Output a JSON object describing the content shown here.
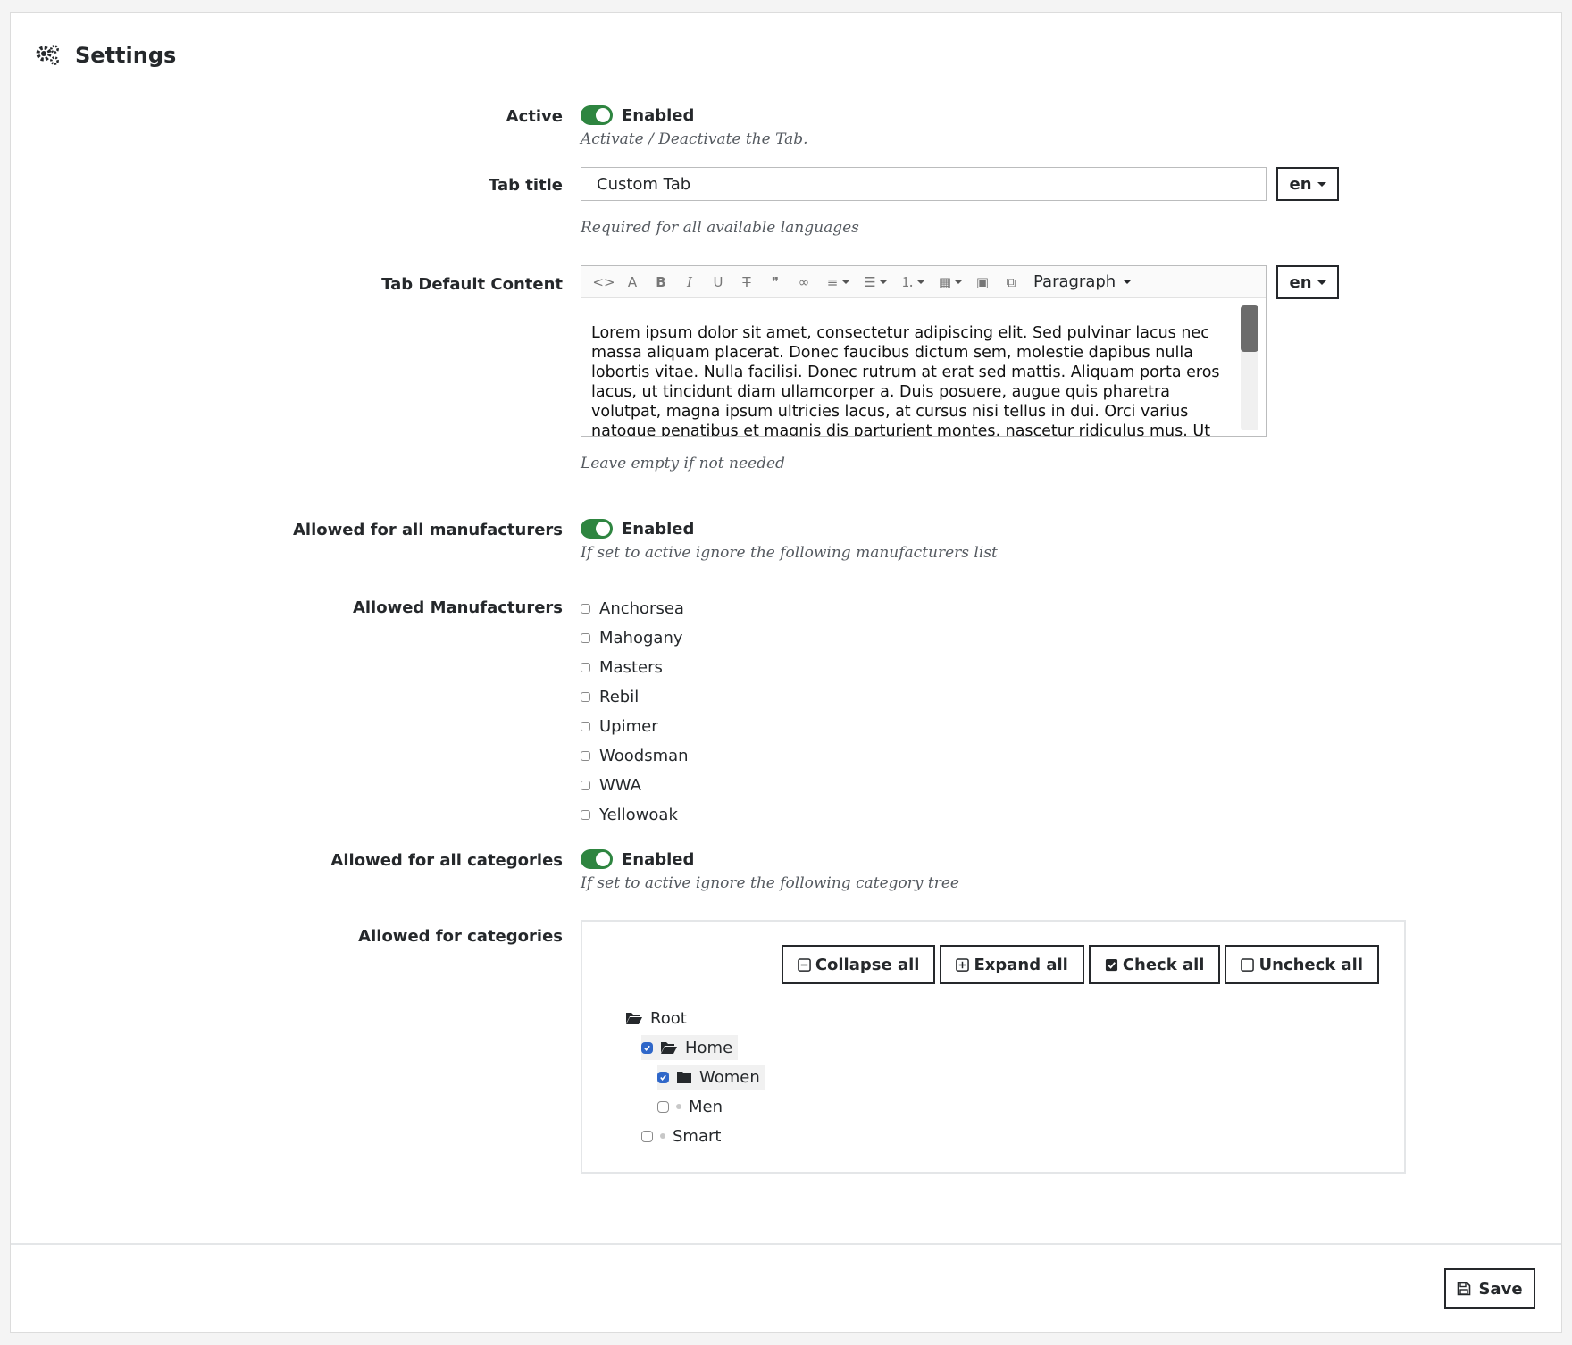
{
  "header": {
    "title": "Settings"
  },
  "active": {
    "label": "Active",
    "state": "Enabled",
    "help": "Activate / Deactivate the Tab."
  },
  "tab_title": {
    "label": "Tab title",
    "value": "Custom Tab",
    "lang": "en",
    "help": "Required for all available languages"
  },
  "tab_content": {
    "label": "Tab Default Content",
    "lang": "en",
    "paragraph_label": "Paragraph",
    "text": "Lorem ipsum dolor sit amet, consectetur adipiscing elit. Sed pulvinar lacus nec massa aliquam placerat. Donec faucibus dictum sem, molestie dapibus nulla lobortis vitae. Nulla facilisi. Donec rutrum at erat sed mattis. Aliquam porta eros lacus, ut tincidunt diam ullamcorper a. Duis posuere, augue quis pharetra volutpat, magna ipsum ultricies lacus, at cursus nisi tellus in dui. Orci varius natoque penatibus et magnis dis parturient montes, nascetur ridiculus mus. Ut",
    "help": "Leave empty if not needed"
  },
  "all_manufacturers": {
    "label": "Allowed for all manufacturers",
    "state": "Enabled",
    "help": "If set to active ignore the following manufacturers list"
  },
  "manufacturers": {
    "label": "Allowed Manufacturers",
    "items": [
      "Anchorsea",
      "Mahogany",
      "Masters",
      "Rebil",
      "Upimer",
      "Woodsman",
      "WWA",
      "Yellowoak"
    ]
  },
  "all_categories": {
    "label": "Allowed for all categories",
    "state": "Enabled",
    "help": "If set to active ignore the following category tree"
  },
  "categories": {
    "label": "Allowed for categories",
    "buttons": {
      "collapse": "Collapse all",
      "expand": "Expand all",
      "check": "Check all",
      "uncheck": "Uncheck all"
    },
    "tree": {
      "root": "Root",
      "home": "Home",
      "women": "Women",
      "men": "Men",
      "smart": "Smart"
    }
  },
  "footer": {
    "save_label": "Save"
  },
  "colors": {
    "toggle_on": "#2e8540",
    "check_blue": "#2f67c9",
    "text": "#25282b"
  }
}
